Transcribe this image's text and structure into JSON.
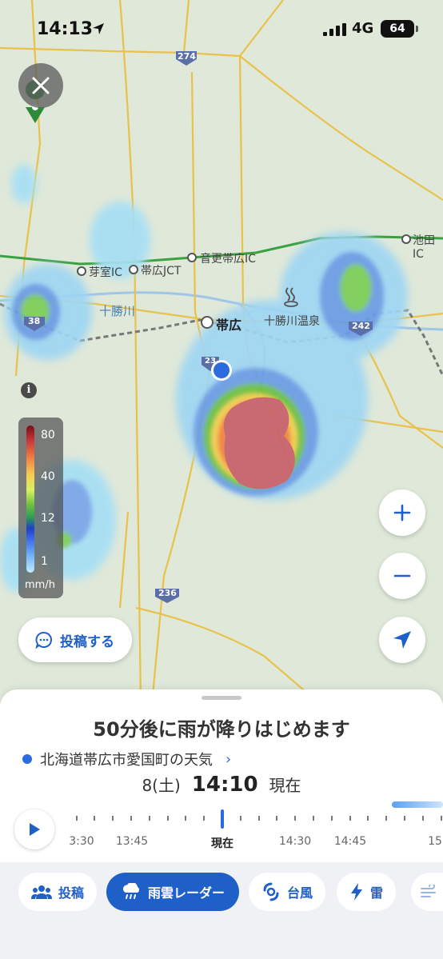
{
  "status_bar": {
    "time": "14:13",
    "network": "4G",
    "battery": "64"
  },
  "map": {
    "labels": {
      "route_274": "274",
      "memuro_ic": "芽室IC",
      "obihiro_jct": "帯広JCT",
      "otofuke_obihiro_ic": "音更帯広IC",
      "ikeda_ic": "池田IC",
      "tokachi_river": "十勝川",
      "obihiro": "帯広",
      "tokachi_onsen": "十勝川温泉",
      "route_38": "38",
      "route_242": "242",
      "route_236": "236",
      "route_23": "23"
    },
    "legend": {
      "values": [
        "80",
        "40",
        "12",
        "1"
      ],
      "unit": "mm/h"
    },
    "post_button": "投稿する"
  },
  "sheet": {
    "headline": "50分後に雨が降りはじめます",
    "place": "北海道帯広市愛国町の天気",
    "date": "8(土)",
    "time": "14:10",
    "now_label": "現在",
    "timeline_labels": [
      "3:30",
      "13:45",
      "現在",
      "14:30",
      "14:45",
      "15"
    ]
  },
  "tabs": [
    {
      "label": "投稿",
      "icon": "people-icon"
    },
    {
      "label": "雨雲レーダー",
      "icon": "rain-cloud-icon"
    },
    {
      "label": "台風",
      "icon": "typhoon-icon"
    },
    {
      "label": "雷",
      "icon": "lightning-icon"
    }
  ],
  "colors": {
    "accent": "#1f5fc8",
    "map_bg": "#dfe8d9",
    "road_yellow": "#e8c24a",
    "road_green": "#3aa040"
  }
}
